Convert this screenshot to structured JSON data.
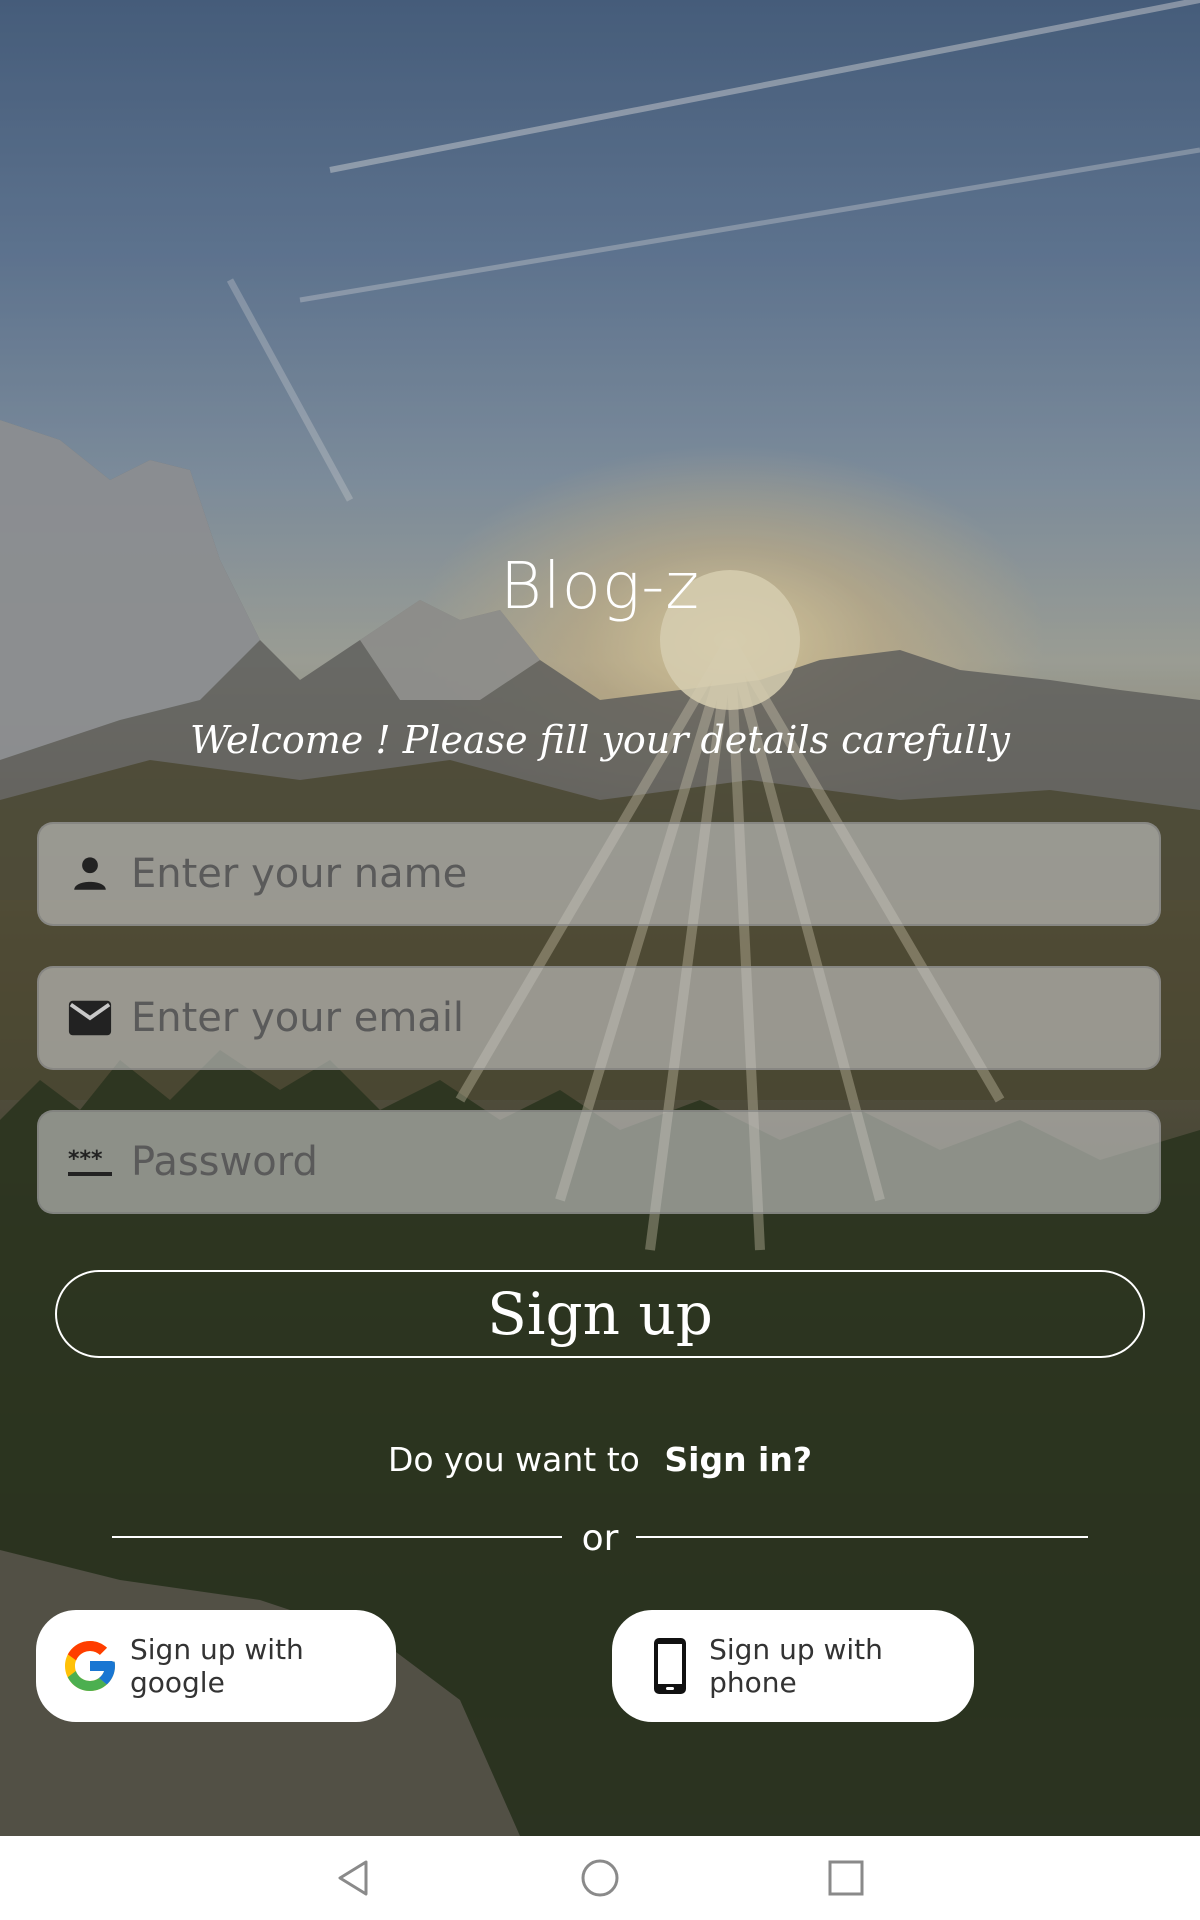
{
  "app": {
    "title": "Blog-z",
    "subtitle": "Welcome ! Please fill your details carefully"
  },
  "form": {
    "name": {
      "placeholder": "Enter your name",
      "icon": "person-icon"
    },
    "email": {
      "placeholder": "Enter your email",
      "icon": "mail-icon"
    },
    "password": {
      "placeholder": "Password",
      "icon": "password-icon"
    },
    "submit_label": "Sign up"
  },
  "signin": {
    "prompt": "Do you want to",
    "link": "Sign in?"
  },
  "divider": {
    "label": "or"
  },
  "social": {
    "google": {
      "label": "Sign up with google",
      "icon": "google-icon"
    },
    "phone": {
      "label": "Sign up with phone",
      "icon": "phone-icon"
    }
  },
  "navbar": {
    "back": "back-icon",
    "home": "home-icon",
    "recents": "recents-icon"
  },
  "colors": {
    "text": "#ffffff",
    "field_bg": "#c8c8c8",
    "placeholder": "#5a5a5a",
    "button_border": "#ffffff"
  }
}
